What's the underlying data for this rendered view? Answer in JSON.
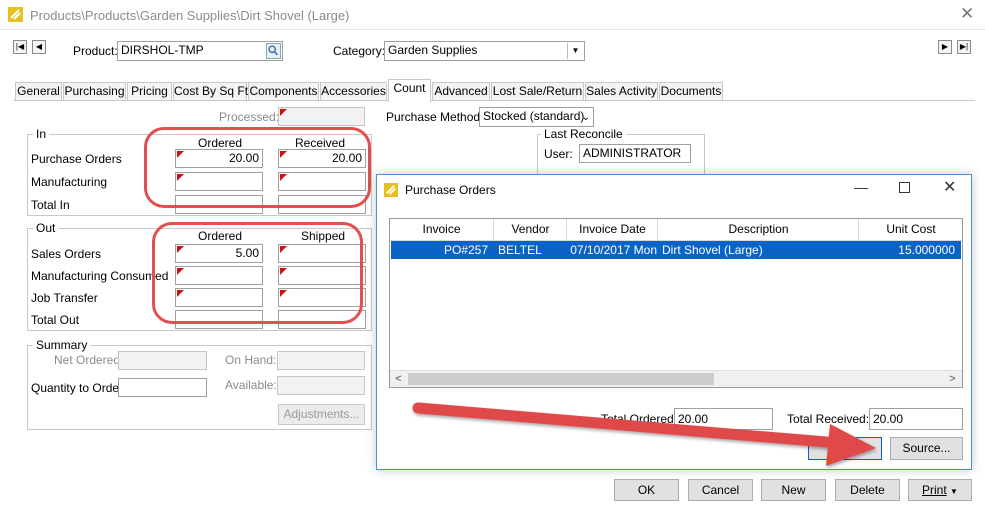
{
  "window": {
    "title": "Products\\Products\\Garden Supplies\\Dirt Shovel (Large)"
  },
  "header": {
    "product_label": "Product:",
    "product_value": "DIRSHOL-TMP",
    "category_label": "Category:",
    "category_value": "Garden Supplies"
  },
  "tabs": [
    {
      "label": "General"
    },
    {
      "label": "Purchasing"
    },
    {
      "label": "Pricing"
    },
    {
      "label": "Cost By Sq Ft"
    },
    {
      "label": "Components"
    },
    {
      "label": "Accessories"
    },
    {
      "label": "Count"
    },
    {
      "label": "Advanced"
    },
    {
      "label": "Lost Sale/Return"
    },
    {
      "label": "Sales Activity"
    },
    {
      "label": "Documents"
    }
  ],
  "count": {
    "processed_label": "Processed:",
    "in": {
      "title": "In",
      "col_ordered": "Ordered",
      "col_received": "Received",
      "rows": [
        {
          "label": "Purchase Orders",
          "ordered": "20.00",
          "received": "20.00"
        },
        {
          "label": "Manufacturing",
          "ordered": "",
          "received": ""
        },
        {
          "label": "Total In",
          "ordered": "",
          "received": ""
        }
      ]
    },
    "out": {
      "title": "Out",
      "col_ordered": "Ordered",
      "col_shipped": "Shipped",
      "rows": [
        {
          "label": "Sales Orders",
          "ordered": "5.00",
          "shipped": ""
        },
        {
          "label": "Manufacturing Consumed",
          "ordered": "",
          "shipped": ""
        },
        {
          "label": "Job Transfer",
          "ordered": "",
          "shipped": ""
        },
        {
          "label": "Total Out",
          "ordered": "",
          "shipped": ""
        }
      ]
    },
    "summary": {
      "title": "Summary",
      "net_ordered_label": "Net Ordered:",
      "on_hand_label": "On Hand:",
      "qty_to_order_label": "Quantity to Order:",
      "available_label": "Available:",
      "adjustments_label": "Adjustments..."
    },
    "purchase_method_label": "Purchase Method:",
    "purchase_method_value": "Stocked (standard)",
    "last_reconcile_title": "Last Reconcile",
    "user_label": "User:",
    "user_value": "ADMINISTRATOR"
  },
  "dialog": {
    "title": "Purchase Orders",
    "columns": [
      "Invoice",
      "Vendor",
      "Invoice Date",
      "Description",
      "Unit Cost"
    ],
    "rows": [
      {
        "invoice": "PO#257",
        "vendor": "BELTEL",
        "invoice_date": "07/10/2017 Mon",
        "description": "Dirt Shovel (Large)",
        "unit_cost": "15.000000"
      }
    ],
    "total_ordered_label": "Total Ordered:",
    "total_ordered_value": "20.00",
    "total_received_label": "Total Received:",
    "total_received_value": "20.00",
    "source_label": "Source..."
  },
  "buttons": {
    "ok": "OK",
    "cancel": "Cancel",
    "new": "New",
    "delete": "Delete",
    "print": "Print"
  },
  "colors": {
    "selection": "#0a64c8",
    "annotation": "#e05050",
    "required_marker": "#d01010"
  }
}
